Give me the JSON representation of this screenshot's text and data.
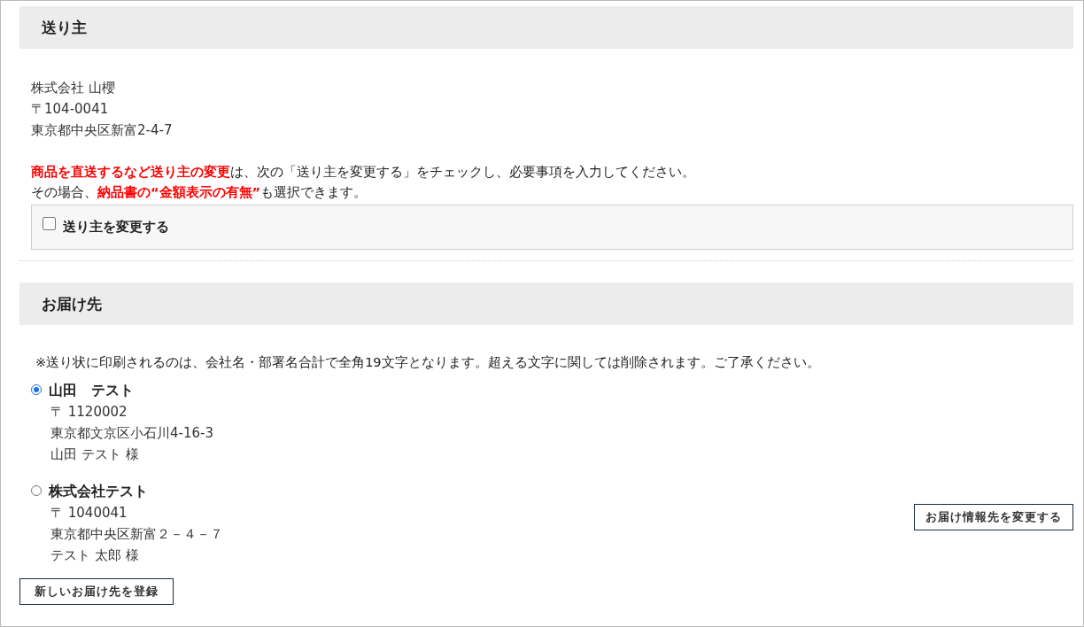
{
  "sender": {
    "title": "送り主",
    "lines": [
      "株式会社 山櫻",
      "〒104-0041",
      "東京都中央区新富2-4-7"
    ],
    "notice": [
      "**商品を直送するなど送り主の変更**は、次の「送り主を変更する」をチェックし、必要事項を入力してください。",
      "その場合、**納品書の“金額表示の有無”**も選択できます。"
    ],
    "change_sender": {
      "label": "送り主を変更する",
      "checked": false
    }
  },
  "delivery": {
    "title": "お届け先",
    "note": "※送り状に印刷されるのは、会社名・部署名合計で全角19文字となります。超える文字に関しては削除されます。ご了承ください。",
    "addresses": [
      {
        "name": "山田　テスト",
        "postal": "〒 1120002",
        "address": "東京都文京区小石川4-16-3",
        "recipient": "山田 テスト 様",
        "selected": true
      },
      {
        "name": "株式会社テスト",
        "postal": "〒 1040041",
        "address": "東京都中央区新富２－４－７",
        "recipient": "テスト 太郎 様",
        "selected": false
      }
    ],
    "change_button": "お届け情報先を変更する",
    "register_button": "新しいお届け先を登録"
  }
}
